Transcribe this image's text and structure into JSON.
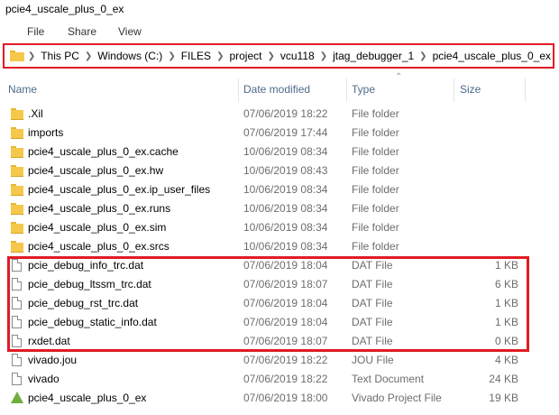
{
  "window": {
    "title": "pcie4_uscale_plus_0_ex"
  },
  "menu": [
    "File",
    "Share",
    "View"
  ],
  "address_bar": {
    "segments": [
      "This PC",
      "Windows (C:)",
      "FILES",
      "project",
      "vcu118",
      "jtag_debugger_1",
      "pcie4_uscale_plus_0_ex"
    ],
    "highlight_color": "#e01b24"
  },
  "columns": {
    "name": "Name",
    "date": "Date modified",
    "type": "Type",
    "size": "Size"
  },
  "files": [
    {
      "name": ".Xil",
      "date": "07/06/2019 18:22",
      "type": "File folder",
      "size": "",
      "icon": "folder-icon"
    },
    {
      "name": "imports",
      "date": "07/06/2019 17:44",
      "type": "File folder",
      "size": "",
      "icon": "folder-icon"
    },
    {
      "name": "pcie4_uscale_plus_0_ex.cache",
      "date": "10/06/2019 08:34",
      "type": "File folder",
      "size": "",
      "icon": "folder-icon"
    },
    {
      "name": "pcie4_uscale_plus_0_ex.hw",
      "date": "10/06/2019 08:43",
      "type": "File folder",
      "size": "",
      "icon": "folder-icon"
    },
    {
      "name": "pcie4_uscale_plus_0_ex.ip_user_files",
      "date": "10/06/2019 08:34",
      "type": "File folder",
      "size": "",
      "icon": "folder-icon"
    },
    {
      "name": "pcie4_uscale_plus_0_ex.runs",
      "date": "10/06/2019 08:34",
      "type": "File folder",
      "size": "",
      "icon": "folder-icon"
    },
    {
      "name": "pcie4_uscale_plus_0_ex.sim",
      "date": "10/06/2019 08:34",
      "type": "File folder",
      "size": "",
      "icon": "folder-icon"
    },
    {
      "name": "pcie4_uscale_plus_0_ex.srcs",
      "date": "10/06/2019 08:34",
      "type": "File folder",
      "size": "",
      "icon": "folder-icon"
    },
    {
      "name": "pcie_debug_info_trc.dat",
      "date": "07/06/2019 18:04",
      "type": "DAT File",
      "size": "1 KB",
      "icon": "file-icon"
    },
    {
      "name": "pcie_debug_ltssm_trc.dat",
      "date": "07/06/2019 18:07",
      "type": "DAT File",
      "size": "6 KB",
      "icon": "file-icon"
    },
    {
      "name": "pcie_debug_rst_trc.dat",
      "date": "07/06/2019 18:04",
      "type": "DAT File",
      "size": "1 KB",
      "icon": "file-icon"
    },
    {
      "name": "pcie_debug_static_info.dat",
      "date": "07/06/2019 18:04",
      "type": "DAT File",
      "size": "1 KB",
      "icon": "file-icon"
    },
    {
      "name": "rxdet.dat",
      "date": "07/06/2019 18:07",
      "type": "DAT File",
      "size": "0 KB",
      "icon": "file-icon"
    },
    {
      "name": "vivado.jou",
      "date": "07/06/2019 18:22",
      "type": "JOU File",
      "size": "4 KB",
      "icon": "file-icon"
    },
    {
      "name": "vivado",
      "date": "07/06/2019 18:22",
      "type": "Text Document",
      "size": "24 KB",
      "icon": "file-icon"
    },
    {
      "name": "pcie4_uscale_plus_0_ex",
      "date": "07/06/2019 18:00",
      "type": "Vivado Project File",
      "size": "19 KB",
      "icon": "vivado-project-icon"
    }
  ],
  "highlight": {
    "rows": [
      "pcie_debug_info_trc.dat",
      "pcie_debug_ltssm_trc.dat",
      "pcie_debug_rst_trc.dat",
      "pcie_debug_static_info.dat",
      "rxdet.dat"
    ],
    "color": "#e01b24"
  }
}
